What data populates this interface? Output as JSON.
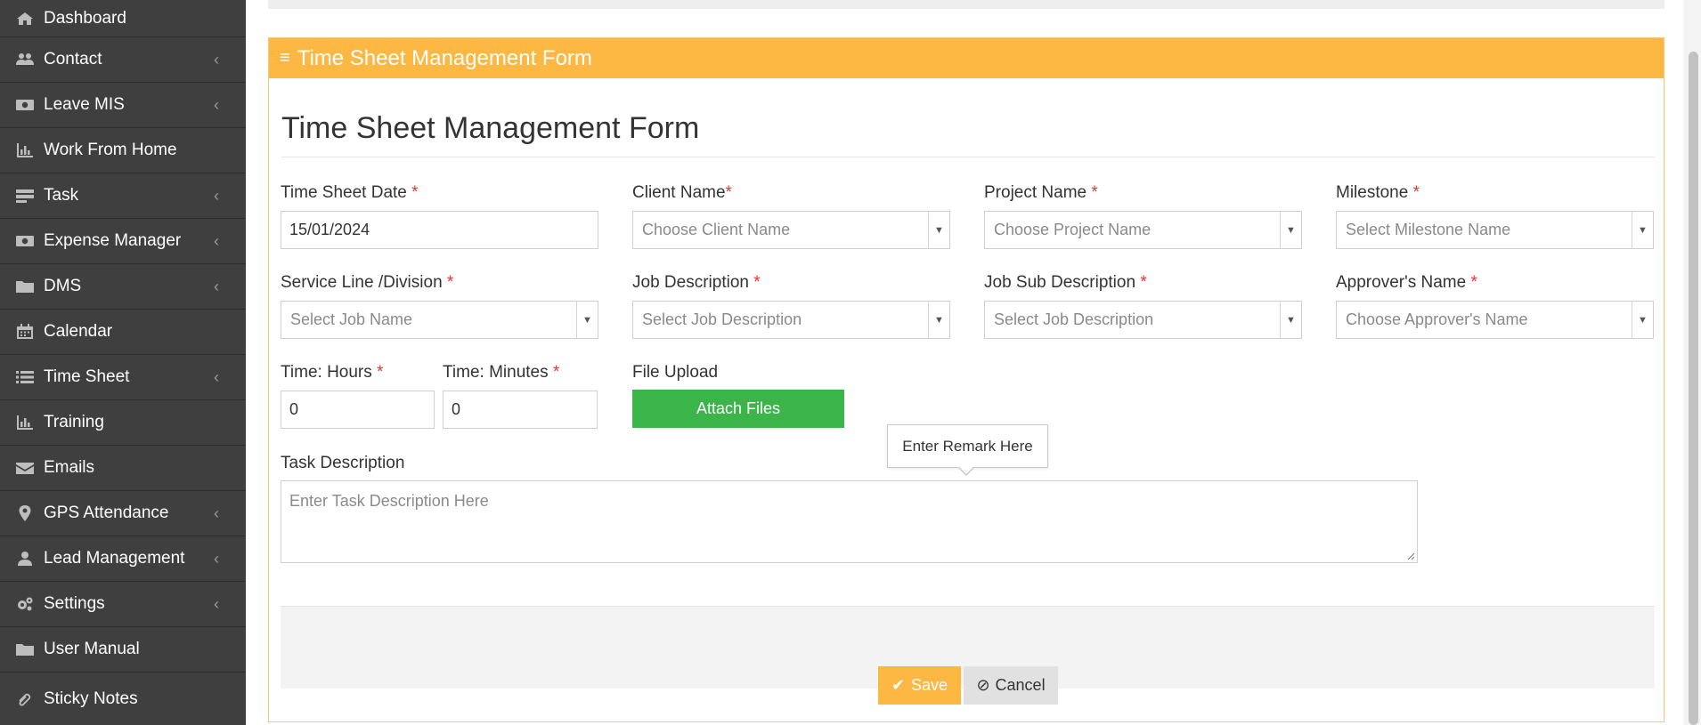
{
  "sidebar": {
    "items": [
      {
        "label": "Dashboard",
        "icon": "home-icon",
        "has_submenu": false
      },
      {
        "label": "Contact",
        "icon": "users-icon",
        "has_submenu": true
      },
      {
        "label": "Leave MIS",
        "icon": "money-icon",
        "has_submenu": true
      },
      {
        "label": "Work From Home",
        "icon": "bar-chart-icon",
        "has_submenu": false
      },
      {
        "label": "Task",
        "icon": "tasks-icon",
        "has_submenu": true
      },
      {
        "label": "Expense Manager",
        "icon": "money-icon",
        "has_submenu": true
      },
      {
        "label": "DMS",
        "icon": "folder-icon",
        "has_submenu": true
      },
      {
        "label": "Calendar",
        "icon": "calendar-icon",
        "has_submenu": false
      },
      {
        "label": "Time Sheet",
        "icon": "list-icon",
        "has_submenu": true
      },
      {
        "label": "Training",
        "icon": "bar-chart-icon",
        "has_submenu": false
      },
      {
        "label": "Emails",
        "icon": "envelope-icon",
        "has_submenu": false
      },
      {
        "label": "GPS Attendance",
        "icon": "map-marker-icon",
        "has_submenu": true
      },
      {
        "label": "Lead Management",
        "icon": "user-icon",
        "has_submenu": true
      },
      {
        "label": "Settings",
        "icon": "gears-icon",
        "has_submenu": true
      },
      {
        "label": "User Manual",
        "icon": "folder-icon",
        "has_submenu": false
      },
      {
        "label": "Sticky Notes",
        "icon": "paperclip-icon",
        "has_submenu": false
      }
    ],
    "chevron": "‹"
  },
  "panel": {
    "header": "Time Sheet Management Form",
    "title": "Time Sheet Management Form"
  },
  "form": {
    "timesheet_date": {
      "label": "Time Sheet Date ",
      "required": "*",
      "value": "15/01/2024"
    },
    "client_name": {
      "label": "Client Name",
      "required": "*",
      "placeholder": "Choose Client Name"
    },
    "project_name": {
      "label": "Project Name ",
      "required": "*",
      "placeholder": "Choose Project Name"
    },
    "milestone": {
      "label": "Milestone ",
      "required": "*",
      "placeholder": "Select Milestone Name"
    },
    "service_line": {
      "label": "Service Line /Division ",
      "required": "*",
      "placeholder": "Select Job Name"
    },
    "job_description": {
      "label": "Job Description ",
      "required": "*",
      "placeholder": "Select Job Description"
    },
    "job_sub_description": {
      "label": "Job Sub Description ",
      "required": "*",
      "placeholder": "Select Job Description"
    },
    "approver_name": {
      "label": "Approver's Name ",
      "required": "*",
      "placeholder": "Choose Approver's Name"
    },
    "time_hours": {
      "label": "Time: Hours ",
      "required": "*",
      "value": "0"
    },
    "time_minutes": {
      "label": "Time: Minutes ",
      "required": "*",
      "value": "0"
    },
    "file_upload": {
      "label": "File Upload",
      "button": "Attach Files"
    },
    "task_description": {
      "label": "Task Description",
      "placeholder": "Enter Task Description Here"
    },
    "tooltip": "Enter Remark Here"
  },
  "actions": {
    "save": "Save",
    "cancel": "Cancel"
  },
  "colors": {
    "sidebar_bg": "#3f3f3f",
    "panel_header": "#fdb843",
    "attach_button": "#3bb44a",
    "required": "#ee3333"
  }
}
